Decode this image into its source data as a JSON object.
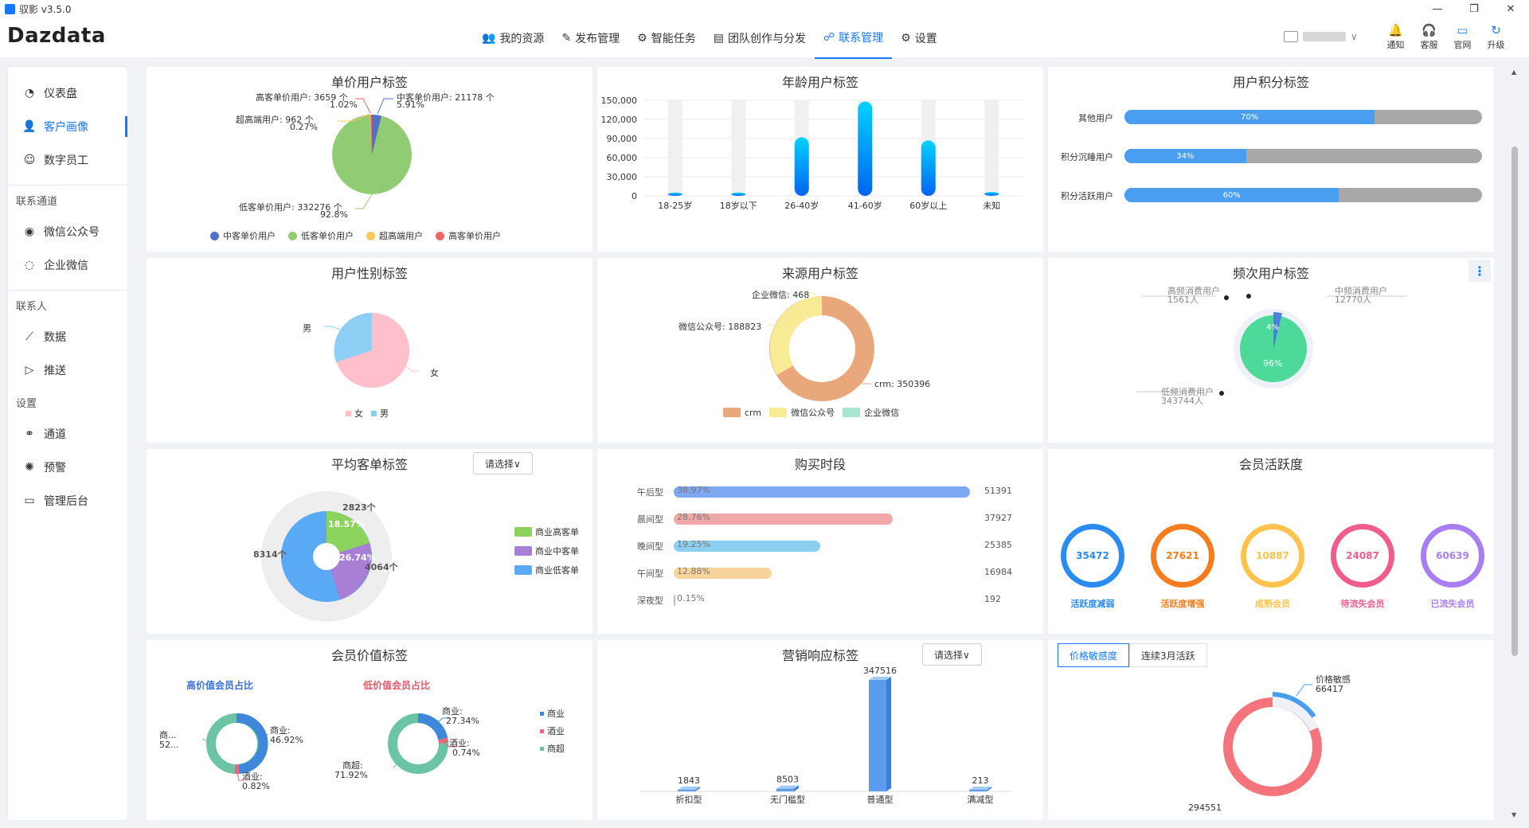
{
  "app": {
    "title": "驭影 v3.5.0",
    "brand": "Dazdata"
  },
  "nav": [
    {
      "label": "我的资源",
      "icon": "user-group-icon"
    },
    {
      "label": "发布管理",
      "icon": "edit-icon"
    },
    {
      "label": "智能任务",
      "icon": "robot-icon"
    },
    {
      "label": "团队创作与分发",
      "icon": "document-icon"
    },
    {
      "label": "联系管理",
      "icon": "contact-icon"
    },
    {
      "label": "设置",
      "icon": "gear-icon"
    }
  ],
  "tools": [
    {
      "label": "通知",
      "icon": "bell-icon"
    },
    {
      "label": "客服",
      "icon": "headset-icon"
    },
    {
      "label": "官网",
      "icon": "monitor-icon"
    },
    {
      "label": "升级",
      "icon": "refresh-icon"
    }
  ],
  "sidebar": {
    "top": [
      {
        "label": "仪表盘",
        "icon": "dashboard-icon"
      },
      {
        "label": "客户画像",
        "icon": "person-icon"
      },
      {
        "label": "数字员工",
        "icon": "robot-icon"
      }
    ],
    "sections": [
      {
        "title": "联系通道",
        "items": [
          {
            "label": "微信公众号",
            "icon": "wechat-icon"
          },
          {
            "label": "企业微信",
            "icon": "chat-icon"
          }
        ]
      },
      {
        "title": "联系人",
        "items": [
          {
            "label": "数据",
            "icon": "chart-icon"
          },
          {
            "label": "推送",
            "icon": "send-icon"
          }
        ]
      },
      {
        "title": "设置",
        "items": [
          {
            "label": "通道",
            "icon": "link-icon"
          },
          {
            "label": "预警",
            "icon": "bug-icon"
          },
          {
            "label": "管理后台",
            "icon": "monitor-icon"
          }
        ]
      }
    ]
  },
  "panels": {
    "unit_price": {
      "title": "单价用户标签",
      "labels": [
        "高客单价用户: 3659 个",
        "1.02%",
        "中客单价用户: 21178 个",
        "5.91%",
        "超高端用户: 962 个",
        "0.27%",
        "低客单价用户: 332276 个",
        "92.8%"
      ],
      "legend": [
        "中客单价用户",
        "低客单价用户",
        "超高端用户",
        "高客单价用户"
      ]
    },
    "age": {
      "title": "年龄用户标签",
      "yticks": [
        "150,000",
        "120,000",
        "90,000",
        "60,000",
        "30,000",
        "0"
      ],
      "categories": [
        "18-25岁",
        "18岁以下",
        "26-40岁",
        "41-60岁",
        "60岁以上",
        "未知"
      ],
      "values": [
        4000,
        5000,
        92000,
        148000,
        87000,
        6000
      ],
      "ymax": 150000
    },
    "points": {
      "title": "用户积分标签",
      "rows": [
        {
          "label": "其他用户",
          "pct": "70%",
          "value": 70
        },
        {
          "label": "积分沉睡用户",
          "pct": "34%",
          "value": 34
        },
        {
          "label": "积分活跃用户",
          "pct": "60%",
          "value": 60
        }
      ]
    },
    "gender": {
      "title": "用户性别标签",
      "labels": [
        "男",
        "女"
      ],
      "legend": [
        "女",
        "男"
      ]
    },
    "source": {
      "title": "来源用户标签",
      "labels": [
        "企业微信: 468",
        "微信公众号: 188823",
        "crm: 350396"
      ],
      "legend": [
        "crm",
        "微信公众号",
        "企业微信"
      ]
    },
    "freq": {
      "title": "频次用户标签",
      "labels": [
        "高频消费用户",
        "1561人",
        "中频消费用户",
        "12770人",
        "低频消费用户",
        "343744人",
        "4%",
        "96%"
      ]
    },
    "avg_order": {
      "title": "平均客单标签",
      "select": "请选择∨",
      "labels": [
        "2823个",
        "18.57%",
        "26.74%",
        "8314个",
        "4064个"
      ],
      "legend": [
        "商业高客单",
        "商业中客单",
        "商业低客单"
      ]
    },
    "buy_time": {
      "title": "购买时段",
      "rows": [
        {
          "label": "午后型",
          "pct": "38.97%",
          "value": 51391,
          "display": "51391"
        },
        {
          "label": "晨间型",
          "pct": "28.76%",
          "value": 37927,
          "display": "37927"
        },
        {
          "label": "晚间型",
          "pct": "19.25%",
          "value": 25385,
          "display": "25385"
        },
        {
          "label": "午间型",
          "pct": "12.88%",
          "value": 16984,
          "display": "16984"
        },
        {
          "label": "深夜型",
          "pct": "0.15%",
          "value": 192,
          "display": "192"
        }
      ]
    },
    "activity": {
      "title": "会员活跃度",
      "items": [
        {
          "value": "35472",
          "label": "活跃度减弱",
          "color": "#2a8cf0"
        },
        {
          "value": "27621",
          "label": "活跃度增强",
          "color": "#f57c1f"
        },
        {
          "value": "10887",
          "label": "成熟会员",
          "color": "#ffc24d"
        },
        {
          "value": "24087",
          "label": "待流失会员",
          "color": "#ee5d8c"
        },
        {
          "value": "60639",
          "label": "已流失会员",
          "color": "#a87ff0"
        }
      ]
    },
    "member_value": {
      "title": "会员价值标签",
      "sub1": "高价值会员占比",
      "sub2": "低价值会员占比",
      "labels1": [
        "商...",
        "52...",
        "商业:",
        "46.92%",
        "酒业:",
        "0.82%"
      ],
      "labels2": [
        "商业:",
        "27.34%",
        "酒业:",
        "0.74%",
        "商超:",
        "71.92%"
      ],
      "legend": [
        "商业",
        "酒业",
        "商超"
      ]
    },
    "marketing": {
      "title": "营销响应标签",
      "select": "请选择∨",
      "categories": [
        "折扣型",
        "无门槛型",
        "普通型",
        "满减型"
      ],
      "values": [
        1843,
        8503,
        347516,
        213
      ],
      "labels": [
        "1843",
        "8503",
        "347516",
        "213"
      ]
    },
    "price_sens": {
      "tabs": [
        "价格敏感度",
        "连续3月活跃"
      ],
      "labels": [
        "价格敏感",
        "66417",
        "294551"
      ]
    }
  }
}
